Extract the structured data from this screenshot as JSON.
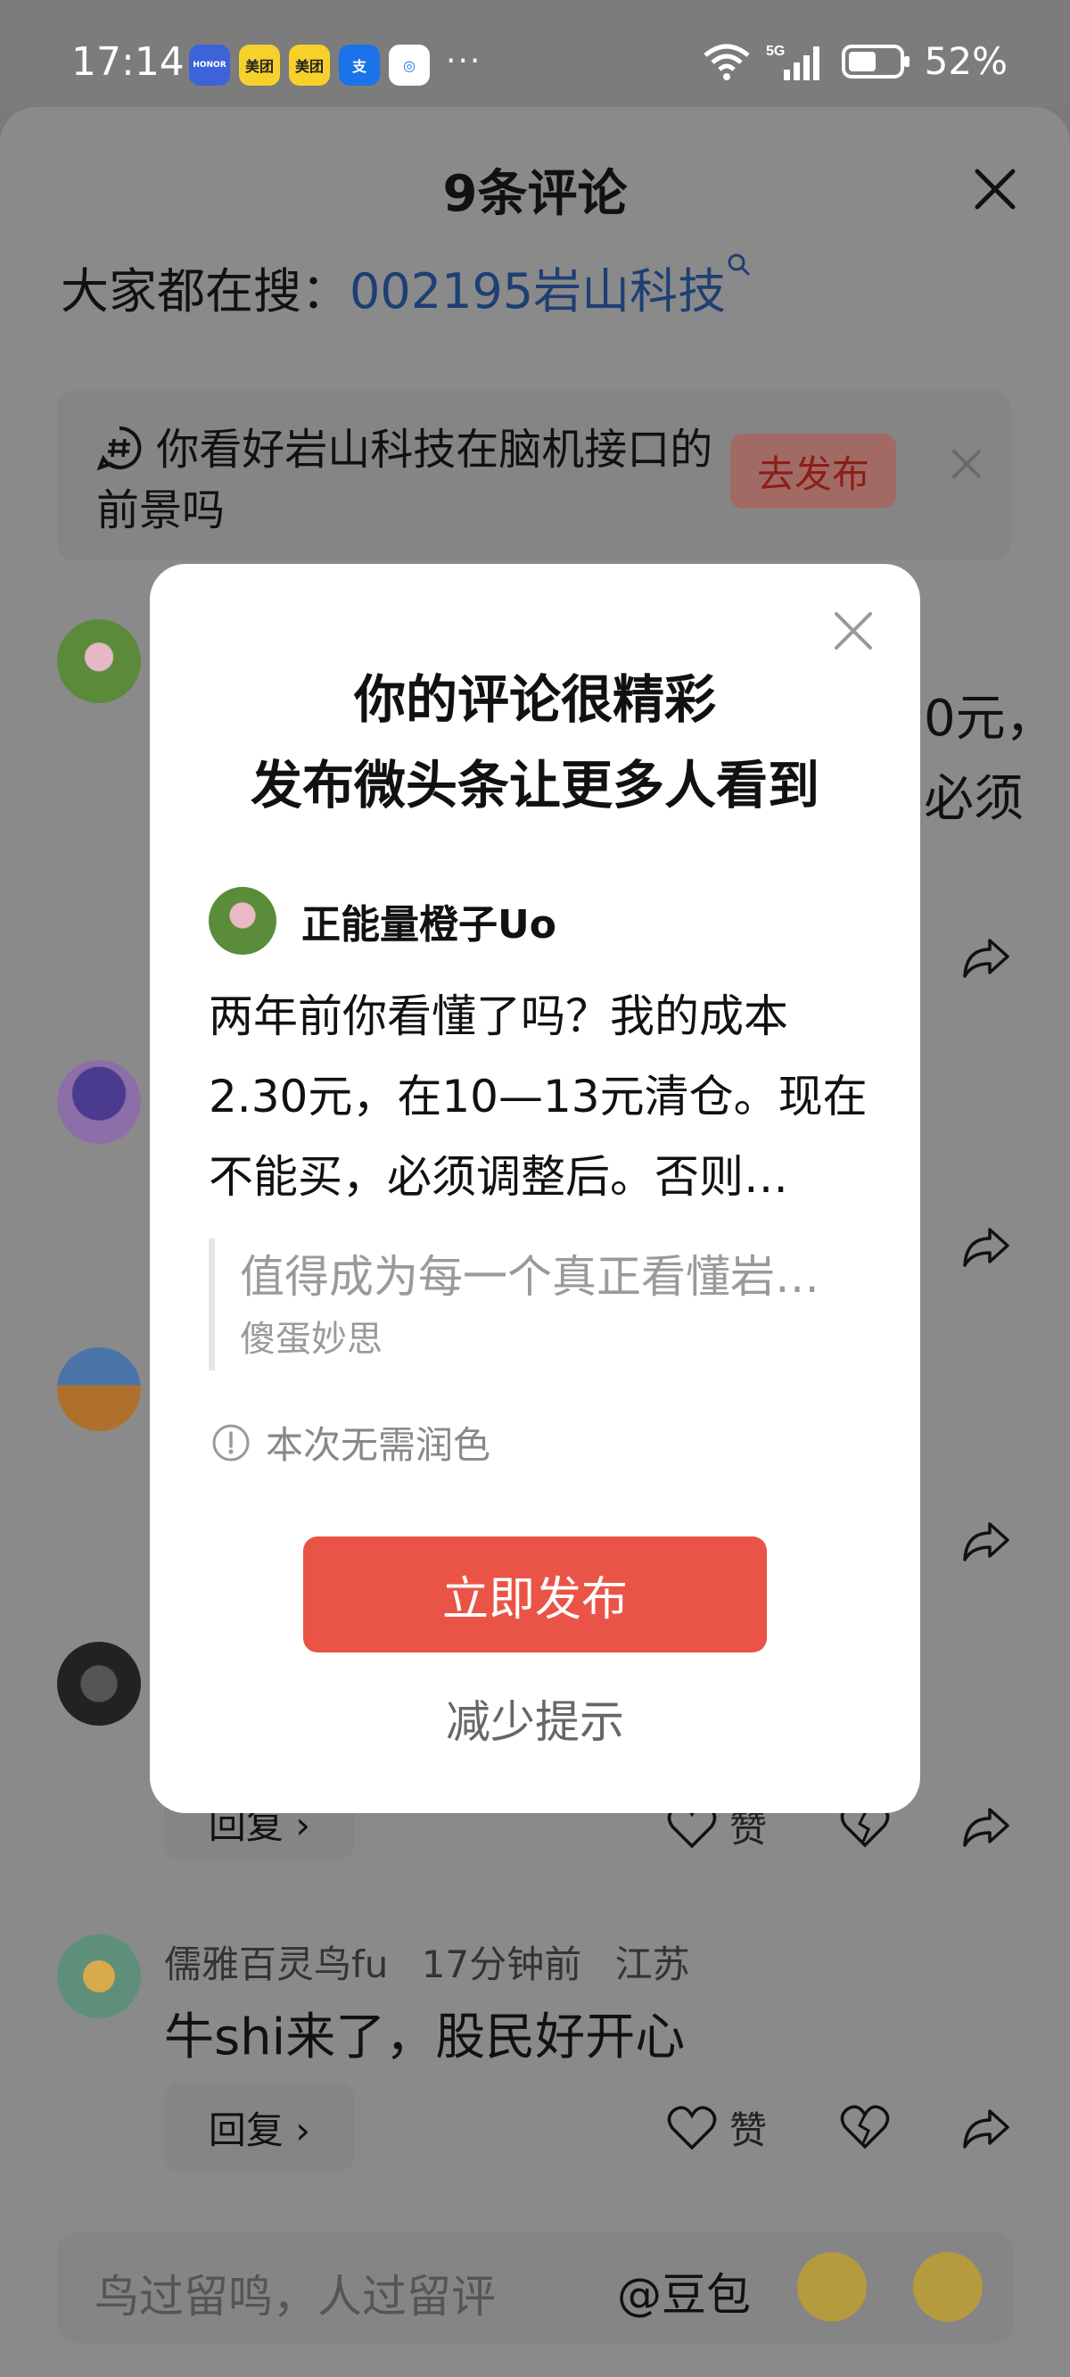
{
  "status_bar": {
    "time": "17:14",
    "apps": [
      {
        "name": "honor-icon",
        "label": "HONOR",
        "bg": "#3d63d8",
        "fg": "#ffffff"
      },
      {
        "name": "meituan-icon",
        "label": "美团",
        "bg": "#f6d12c",
        "fg": "#222222"
      },
      {
        "name": "meituan-icon-2",
        "label": "美团",
        "bg": "#f6d12c",
        "fg": "#222222"
      },
      {
        "name": "alipay-icon",
        "label": "支",
        "bg": "#1a73e8",
        "fg": "#ffffff"
      },
      {
        "name": "chat-icon",
        "label": "◎",
        "bg": "#ffffff",
        "fg": "#1a73e8"
      }
    ],
    "more": "···",
    "network": "5G",
    "wifi_label": "6",
    "battery": "52%"
  },
  "sheet": {
    "title": "9条评论",
    "search_prefix": "大家都在搜：",
    "search_keyword": "002195岩山科技",
    "topic": {
      "text": "你看好岩山科技在脑机接口的前景吗",
      "button": "去发布"
    },
    "bg_fragments": [
      "0元，",
      "必须"
    ],
    "visible_comments": [
      {
        "user": "儒雅百灵鸟fu",
        "time": "17分钟前",
        "location": "江苏",
        "text": "牛shi来了，股民好开心",
        "reply": "回复 ›",
        "like": "赞"
      }
    ],
    "partial_reply": "回复 ›",
    "partial_like": "赞",
    "input": {
      "placeholder": "鸟过留鸣，人过留评",
      "at_label": "@豆包"
    }
  },
  "modal": {
    "title_line1": "你的评论很精彩",
    "title_line2": "发布微头条让更多人看到",
    "username": "正能量橙子Uo",
    "body": "两年前你看懂了吗？我的成本2.30元，在10—13元清仓。现在不能买，必须调整后。否则…",
    "quote_text": "值得成为每一个真正看懂岩…",
    "quote_author": "傻蛋妙思",
    "note": "本次无需润色",
    "primary_button": "立即发布",
    "secondary_button": "减少提示"
  },
  "colors": {
    "accent": "#ea5446",
    "link_blue": "#1e3f73",
    "overlay": "#7a7a7a"
  }
}
